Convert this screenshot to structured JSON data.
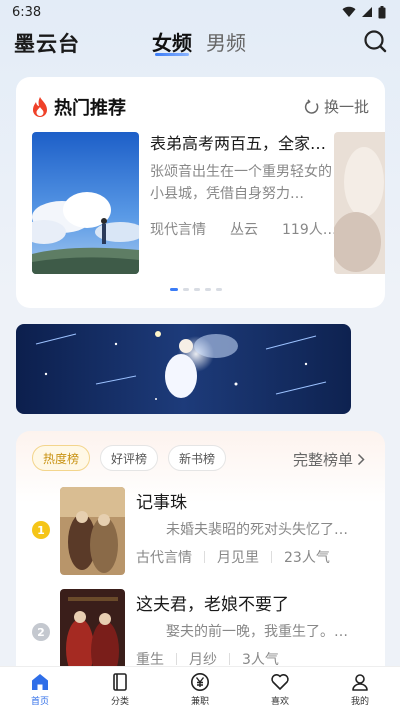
{
  "status_bar": {
    "time": "6:38"
  },
  "header": {
    "logo": "墨云台",
    "tabs": [
      {
        "label": "女频",
        "active": true
      },
      {
        "label": "男频",
        "active": false
      }
    ]
  },
  "hot": {
    "title": "热门推荐",
    "refresh_label": "换一批",
    "book": {
      "title": "表弟高考两百五，全家…",
      "desc": "张颂音出生在一个重男轻女的小县城，凭借自身努力…",
      "genre": "现代言情",
      "author": "丛云",
      "popularity": "119人…"
    },
    "carousel_count": 5,
    "carousel_active": 0
  },
  "rank": {
    "tabs": [
      "热度榜",
      "好评榜",
      "新书榜"
    ],
    "active_tab": "热度榜",
    "more_label": "完整榜单",
    "items": [
      {
        "num": "1",
        "title": "记事珠",
        "desc": "未婚夫裴昭的死对头失忆了…",
        "genre": "古代言情",
        "author": "月见里",
        "popularity": "23人气"
      },
      {
        "num": "2",
        "title": "这夫君，老娘不要了",
        "desc": "娶夫的前一晚，我重生了。…",
        "genre": "重生",
        "author": "月纱",
        "popularity": "3人气"
      }
    ]
  },
  "nav": {
    "items": [
      {
        "label": "首页",
        "icon": "home-icon",
        "active": true
      },
      {
        "label": "分类",
        "icon": "category-icon",
        "active": false
      },
      {
        "label": "兼职",
        "icon": "yen-icon",
        "active": false
      },
      {
        "label": "喜欢",
        "icon": "heart-icon",
        "active": false
      },
      {
        "label": "我的",
        "icon": "user-icon",
        "active": false
      }
    ]
  },
  "colors": {
    "accent": "#3b7cf6",
    "nav_active": "#2f6ee8",
    "rank_gold": "#f5c518",
    "rank_silver": "#c4c8cf"
  }
}
